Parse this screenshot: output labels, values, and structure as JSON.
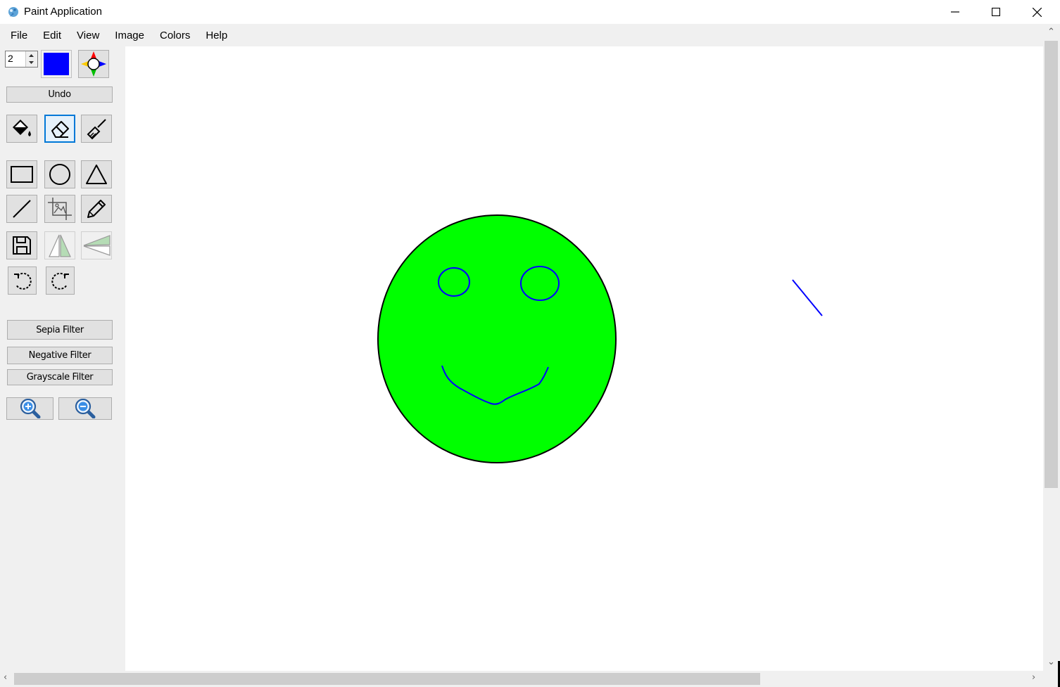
{
  "window": {
    "title": "Paint Application",
    "controls": [
      "minimize",
      "maximize",
      "close"
    ]
  },
  "menu": [
    "File",
    "Edit",
    "View",
    "Image",
    "Colors",
    "Help"
  ],
  "toolbar": {
    "brush_size": "2",
    "current_color": "#0000ff",
    "undo_label": "Undo",
    "selected_tool": "eraser",
    "tools": [
      "fill-bucket",
      "eraser",
      "brush",
      "rectangle",
      "ellipse",
      "triangle",
      "line",
      "crop-image",
      "pencil",
      "save",
      "flip-horizontal",
      "flip-vertical",
      "rotate-left",
      "rotate-right"
    ],
    "filters": {
      "sepia": "Sepia Filter",
      "negative": "Negative Filter",
      "grayscale": "Grayscale Filter"
    },
    "zoom": [
      "zoom-in",
      "zoom-out"
    ]
  },
  "colors": {
    "face_fill": "#00ff00",
    "outline": "#000000",
    "stroke": "#0000ff",
    "accent": "#0078d7"
  }
}
